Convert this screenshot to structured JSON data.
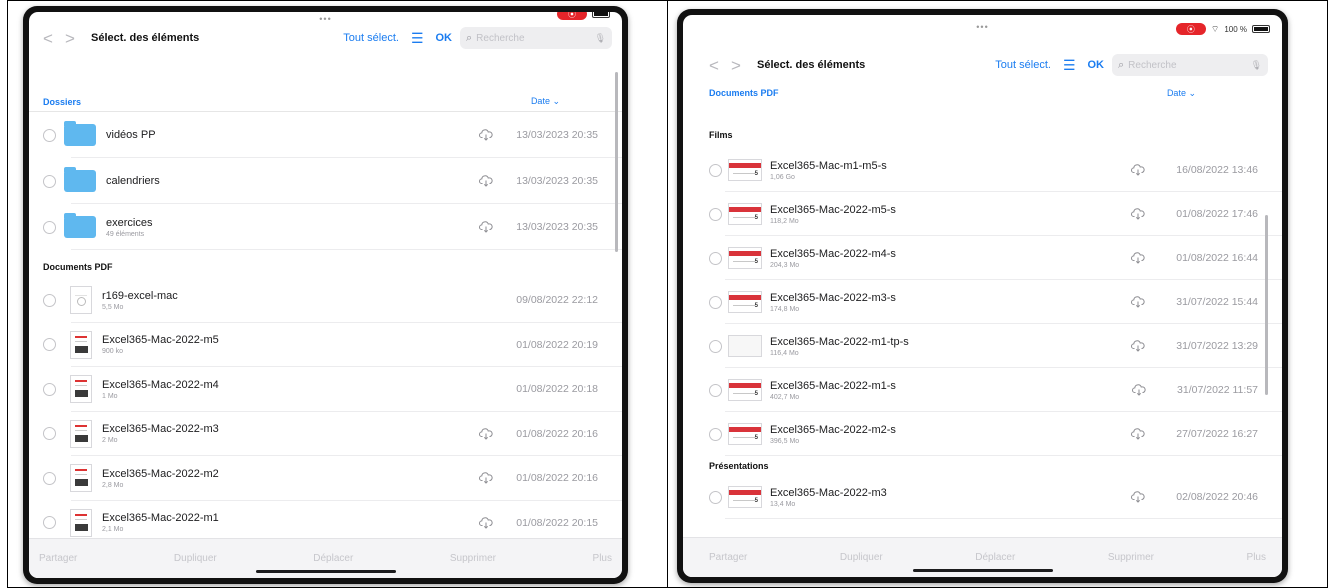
{
  "left": {
    "dots": "•••",
    "toolbar": {
      "back": "<",
      "forward": ">",
      "title": "Sélect. des éléments",
      "select_all": "Tout sélect.",
      "list_icon": "list-icon",
      "ok": "OK",
      "search_placeholder": "Recherche"
    },
    "sort": {
      "section": "Dossiers",
      "date": "Date ⌄"
    },
    "folders": [
      {
        "name": "vidéos PP",
        "sub": "",
        "date": "13/03/2023 20:35",
        "cloud": true
      },
      {
        "name": "calendriers",
        "sub": "",
        "date": "13/03/2023 20:35",
        "cloud": true
      },
      {
        "name": "exercices",
        "sub": "49 éléments",
        "date": "13/03/2023 20:35",
        "cloud": true
      }
    ],
    "pdf_section": "Documents PDF",
    "pdfs": [
      {
        "name": "r169-excel-mac",
        "sub": "5,5 Mo",
        "date": "09/08/2022 22:12",
        "cloud": false,
        "style": "blank"
      },
      {
        "name": "Excel365-Mac-2022-m5",
        "sub": "900 ko",
        "date": "01/08/2022 20:19",
        "cloud": false,
        "style": "cover"
      },
      {
        "name": "Excel365-Mac-2022-m4",
        "sub": "1 Mo",
        "date": "01/08/2022 20:18",
        "cloud": false,
        "style": "cover"
      },
      {
        "name": "Excel365-Mac-2022-m3",
        "sub": "2 Mo",
        "date": "01/08/2022 20:16",
        "cloud": true,
        "style": "cover"
      },
      {
        "name": "Excel365-Mac-2022-m2",
        "sub": "2,8 Mo",
        "date": "01/08/2022 20:16",
        "cloud": true,
        "style": "cover"
      },
      {
        "name": "Excel365-Mac-2022-m1",
        "sub": "2,1 Mo",
        "date": "01/08/2022 20:15",
        "cloud": true,
        "style": "cover"
      }
    ],
    "bottom": [
      "Partager",
      "Dupliquer",
      "Déplacer",
      "Supprimer",
      "Plus"
    ]
  },
  "right": {
    "dots": "•••",
    "status": {
      "battery": "100 %"
    },
    "toolbar": {
      "back": "<",
      "forward": ">",
      "title": "Sélect. des éléments",
      "select_all": "Tout sélect.",
      "list_icon": "list-icon",
      "ok": "OK",
      "search_placeholder": "Recherche"
    },
    "sort": {
      "section": "Documents PDF",
      "date": "Date ⌄"
    },
    "films_section": "Films",
    "films": [
      {
        "name": "Excel365-Mac-m1-m5-s",
        "sub": "1,06 Go",
        "date": "16/08/2022 13:46",
        "style": "cover"
      },
      {
        "name": "Excel365-Mac-2022-m5-s",
        "sub": "118,2 Mo",
        "date": "01/08/2022 17:46",
        "style": "cover"
      },
      {
        "name": "Excel365-Mac-2022-m4-s",
        "sub": "204,3 Mo",
        "date": "01/08/2022 16:44",
        "style": "cover"
      },
      {
        "name": "Excel365-Mac-2022-m3-s",
        "sub": "174,8 Mo",
        "date": "31/07/2022 15:44",
        "style": "cover"
      },
      {
        "name": "Excel365-Mac-2022-m1-tp-s",
        "sub": "116,4 Mo",
        "date": "31/07/2022 13:29",
        "style": "blank"
      },
      {
        "name": "Excel365-Mac-2022-m1-s",
        "sub": "402,7 Mo",
        "date": "31/07/2022 11:57",
        "style": "cover"
      },
      {
        "name": "Excel365-Mac-2022-m2-s",
        "sub": "396,5 Mo",
        "date": "27/07/2022 16:27",
        "style": "cover"
      }
    ],
    "presentations_section": "Présentations",
    "presentations": [
      {
        "name": "Excel365-Mac-2022-m3",
        "sub": "13,4 Mo",
        "date": "02/08/2022 20:46",
        "style": "cover"
      }
    ],
    "bottom": [
      "Partager",
      "Dupliquer",
      "Déplacer",
      "Supprimer",
      "Plus"
    ]
  }
}
